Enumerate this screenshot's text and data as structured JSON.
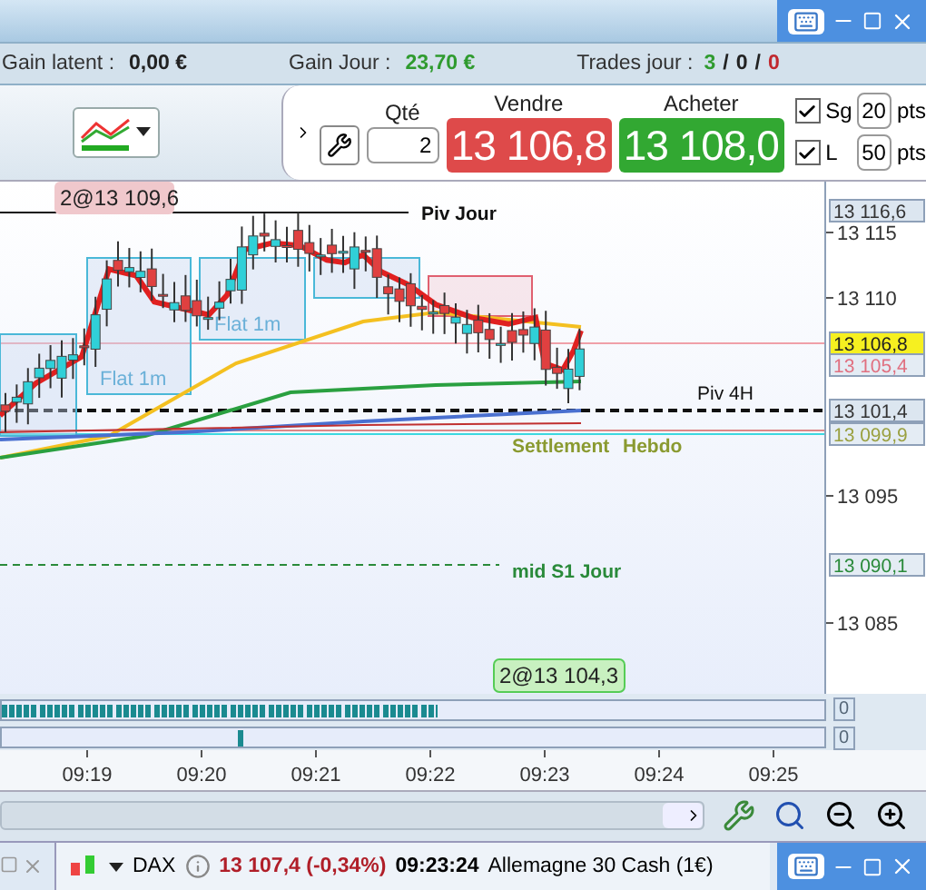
{
  "stats": [
    {
      "label": "Gain latent :",
      "value": "0,00 €",
      "kind": "neutral"
    },
    {
      "label": "Gain Jour :",
      "value": "23,70 €",
      "kind": "gain"
    }
  ],
  "trades": {
    "label": "Trades jour :",
    "separator": "/",
    "counts": [
      {
        "text": "3",
        "kind": "gain"
      },
      {
        "text": "0",
        "kind": "neutral"
      },
      {
        "text": "0",
        "kind": "loss"
      }
    ]
  },
  "order": {
    "qty": {
      "label": "Qté",
      "value": "2"
    },
    "sell": {
      "label": "Vendre",
      "price": "13 106,8"
    },
    "buy": {
      "label": "Acheter",
      "price": "13 108,0"
    },
    "stops": [
      {
        "label": "Sg",
        "checked": true,
        "value": "20",
        "unit": "pts"
      },
      {
        "label": "L",
        "checked": true,
        "value": "50",
        "unit": "pts"
      }
    ]
  },
  "chart": {
    "trade_tags": [
      {
        "text": "2@13 109,6",
        "kind": "sell"
      },
      {
        "text": "2@13 104,3",
        "kind": "buy"
      }
    ],
    "line_labels": [
      {
        "text": "Piv Jour",
        "kind": "pivot"
      },
      {
        "text": "Piv 4H",
        "kind": "pivot"
      },
      {
        "text": "Settlement",
        "kind": "settlement"
      },
      {
        "text": "Hebdo",
        "kind": "settlement"
      },
      {
        "text": "mid S1 Jour",
        "kind": "support"
      }
    ],
    "zone_labels": [
      "Flat 1m",
      "Flat 1m"
    ],
    "price_ticks": [
      "13 115",
      "13 110",
      "13 095",
      "13 085"
    ],
    "price_tags": [
      {
        "text": "13 116,6",
        "kind": "plain"
      },
      {
        "text": "13 106,8",
        "kind": "last"
      },
      {
        "text": "13 105,4",
        "kind": "ma"
      },
      {
        "text": "13 101,4",
        "kind": "plain"
      },
      {
        "text": "13 099,9",
        "kind": "settlement"
      },
      {
        "text": "13 090,1",
        "kind": "support"
      }
    ],
    "time_ticks": [
      "09:19",
      "09:20",
      "09:21",
      "09:22",
      "09:23",
      "09:24",
      "09:25"
    ]
  },
  "indicators": [
    {
      "reading": "0"
    },
    {
      "reading": "0"
    }
  ],
  "status": {
    "symbol": "DAX",
    "quote": "13 107,4 (-0,34%)",
    "time": "09:23:24",
    "name": "Allemagne 30 Cash (1€)"
  }
}
